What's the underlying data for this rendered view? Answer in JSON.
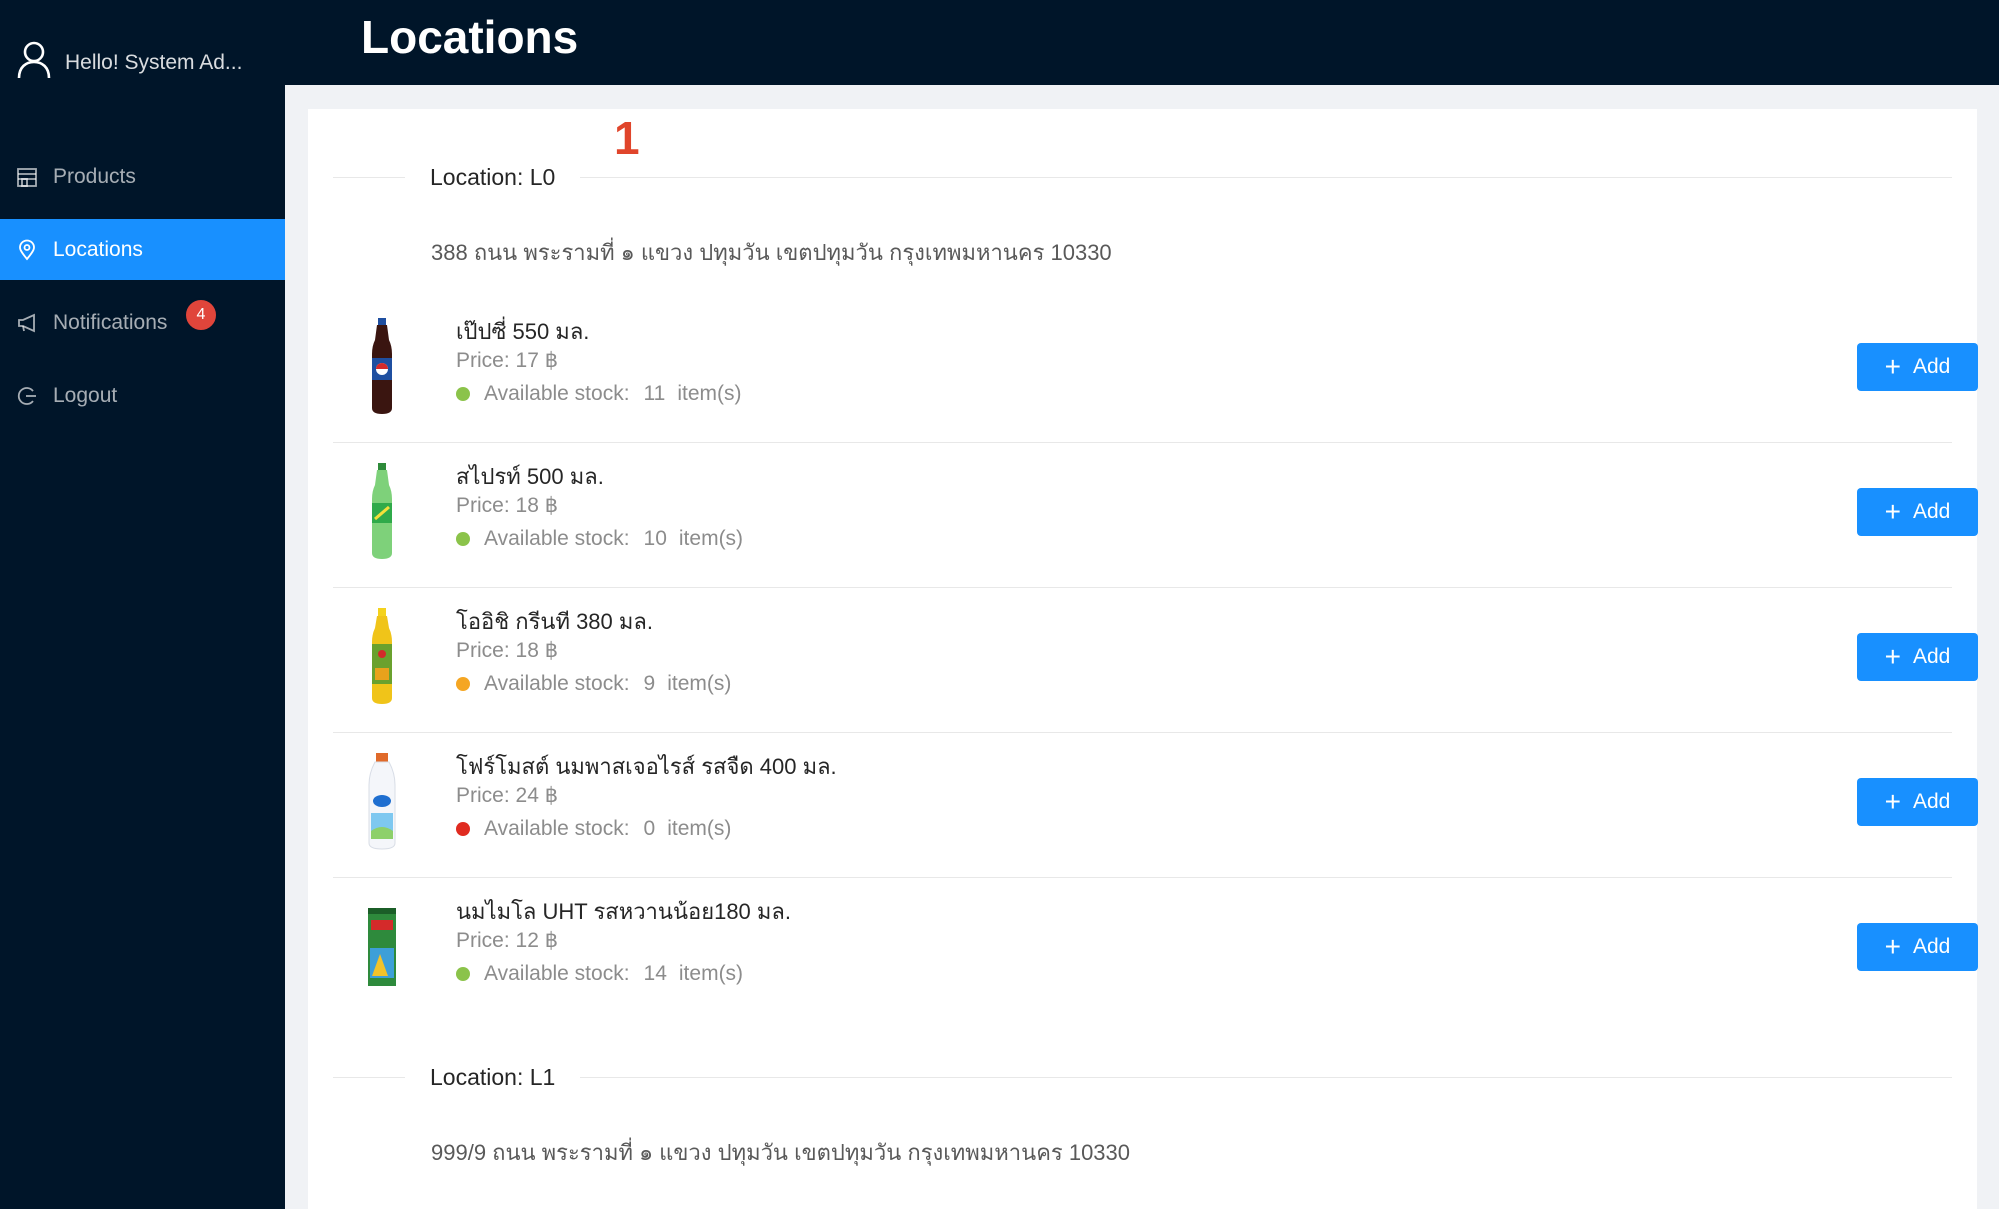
{
  "sidebar": {
    "greeting": "Hello! System Ad...",
    "items": [
      {
        "label": "Products",
        "icon": "shop-icon"
      },
      {
        "label": "Locations",
        "icon": "location-pin-icon"
      },
      {
        "label": "Notifications",
        "icon": "megaphone-icon",
        "badge": "4"
      },
      {
        "label": "Logout",
        "icon": "logout-icon"
      }
    ],
    "active": "Locations"
  },
  "header": {
    "title": "Locations"
  },
  "main": {
    "step_marker": "1",
    "locations": [
      {
        "title": "Location: L0",
        "address": "388 ถนน พระรามที่ ๑ แขวง ปทุมวัน เขตปทุมวัน กรุงเทพมหานคร 10330",
        "products": [
          {
            "name": "เป๊ปซี่ 550 มล.",
            "price": "Price: 17 ฿",
            "stock_label": "Available stock:",
            "stock": "11",
            "unit": "item(s)",
            "status_color": "#8bc34a",
            "button": "Add"
          },
          {
            "name": "สไปรท์ 500 มล.",
            "price": "Price: 18 ฿",
            "stock_label": "Available stock:",
            "stock": "10",
            "unit": "item(s)",
            "status_color": "#8bc34a",
            "button": "Add"
          },
          {
            "name": "โออิชิ กรีนที 380 มล.",
            "price": "Price: 18 ฿",
            "stock_label": "Available stock:",
            "stock": "9",
            "unit": "item(s)",
            "status_color": "#f5a623",
            "button": "Add"
          },
          {
            "name": "โฟร์โมสต์ นมพาสเจอไรส์ รสจืด 400 มล.",
            "price": "Price: 24 ฿",
            "stock_label": "Available stock:",
            "stock": "0",
            "unit": "item(s)",
            "status_color": "#e02b20",
            "button": "Add"
          },
          {
            "name": "นมไมโล UHT รสหวานน้อย180 มล.",
            "price": "Price: 12 ฿",
            "stock_label": "Available stock:",
            "stock": "14",
            "unit": "item(s)",
            "status_color": "#8bc34a",
            "button": "Add"
          }
        ]
      },
      {
        "title": "Location: L1",
        "address": "999/9 ถนน พระรามที่ ๑ แขวง ปทุมวัน เขตปทุมวัน กรุงเทพมหานคร 10330"
      }
    ]
  },
  "colors": {
    "sidebar_bg": "#001529",
    "accent": "#1890ff",
    "badge": "#e0453b",
    "stock_ok": "#8bc34a",
    "stock_low": "#f5a623",
    "stock_out": "#e02b20"
  }
}
